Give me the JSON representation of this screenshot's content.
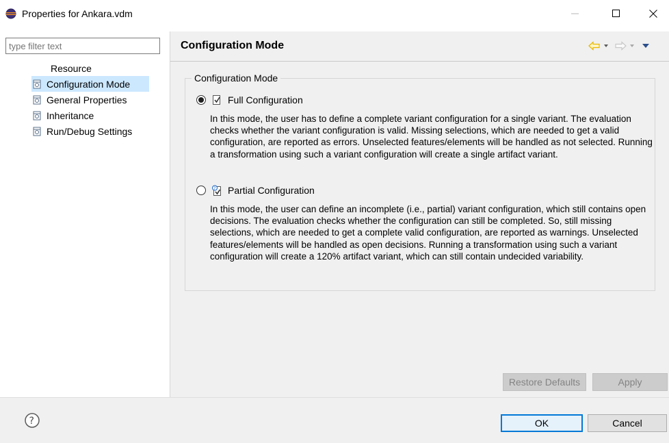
{
  "window": {
    "title": "Properties for Ankara.vdm"
  },
  "filter": {
    "placeholder": "type filter text"
  },
  "tree": {
    "items": [
      {
        "label": "Resource"
      },
      {
        "label": "Configuration Mode"
      },
      {
        "label": "General Properties"
      },
      {
        "label": "Inheritance"
      },
      {
        "label": "Run/Debug Settings"
      }
    ]
  },
  "page": {
    "title": "Configuration Mode",
    "group_label": "Configuration Mode",
    "options": [
      {
        "label": "Full Configuration",
        "selected": true,
        "description": "In this mode, the user has to define a complete variant configuration for a single variant. The evaluation checks whether the variant configuration is valid. Missing selections, which are needed to get a valid configuration, are reported as errors. Unselected features/elements will be handled as not selected. Running a transformation using such a variant configuration will create a single artifact variant."
      },
      {
        "label": "Partial Configuration",
        "selected": false,
        "description": "In this mode, the user can define an incomplete (i.e., partial) variant configuration, which still contains open decisions. The evaluation checks whether the configuration can still be completed. So, still missing selections, which are needed to get a complete valid configuration, are reported as warnings. Unselected features/elements will be handled as open decisions. Running a transformation using such a variant configuration will create a 120% artifact variant, which can still contain undecided variability."
      }
    ]
  },
  "buttons": {
    "restore_defaults": "Restore Defaults",
    "apply": "Apply",
    "ok": "OK",
    "cancel": "Cancel"
  },
  "colors": {
    "selection": "#cce8ff",
    "nav_arrow_active": "#e8b800",
    "nav_dropdown": "#2b4f8c",
    "accent": "#0078d7"
  }
}
